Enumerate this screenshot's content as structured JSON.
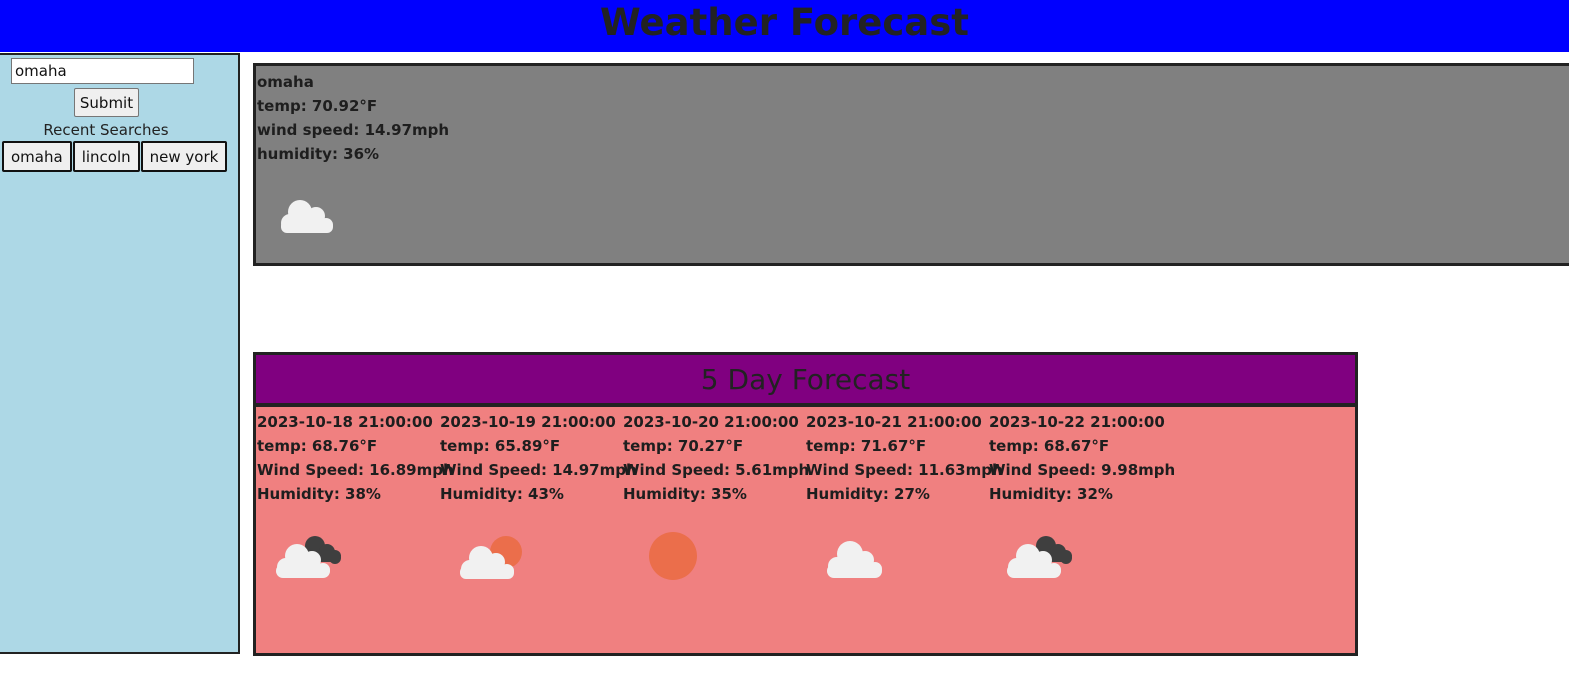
{
  "header": {
    "title": "Weather Forecast"
  },
  "sidebar": {
    "search": {
      "value": "omaha"
    },
    "submit_label": "Submit",
    "recent_label": "Recent Searches",
    "recent": [
      "omaha",
      "lincoln",
      "new york"
    ]
  },
  "current": {
    "city": "omaha",
    "temp": "temp: 70.92°F",
    "wind": "wind speed: 14.97mph",
    "humidity": "humidity: 36%",
    "icon": "cloud-icon"
  },
  "forecast": {
    "title": "5 Day Forecast",
    "days": [
      {
        "date": "2023-10-18 21:00:00",
        "temp": "temp: 68.76°F",
        "wind": "Wind Speed: 16.89mph",
        "humidity": "Humidity: 38%",
        "icon": "broken-clouds-icon"
      },
      {
        "date": "2023-10-19 21:00:00",
        "temp": "temp: 65.89°F",
        "wind": "Wind Speed: 14.97mph",
        "humidity": "Humidity: 43%",
        "icon": "partly-cloudy-icon"
      },
      {
        "date": "2023-10-20 21:00:00",
        "temp": "temp: 70.27°F",
        "wind": "Wind Speed: 5.61mph",
        "humidity": "Humidity: 35%",
        "icon": "sun-icon"
      },
      {
        "date": "2023-10-21 21:00:00",
        "temp": "temp: 71.67°F",
        "wind": "Wind Speed: 11.63mph",
        "humidity": "Humidity: 27%",
        "icon": "cloud-icon"
      },
      {
        "date": "2023-10-22 21:00:00",
        "temp": "temp: 68.67°F",
        "wind": "Wind Speed: 9.98mph",
        "humidity": "Humidity: 32%",
        "icon": "broken-clouds-icon"
      }
    ]
  },
  "colors": {
    "header_bg": "#0000ff",
    "sidebar_bg": "#add8e6",
    "current_bg": "#808080",
    "forecast_header_bg": "#800080",
    "forecast_body_bg": "#f08080",
    "sun": "#eb6e4b",
    "cloud_light": "#f1f1f1",
    "cloud_dark": "#3f3f3f"
  }
}
